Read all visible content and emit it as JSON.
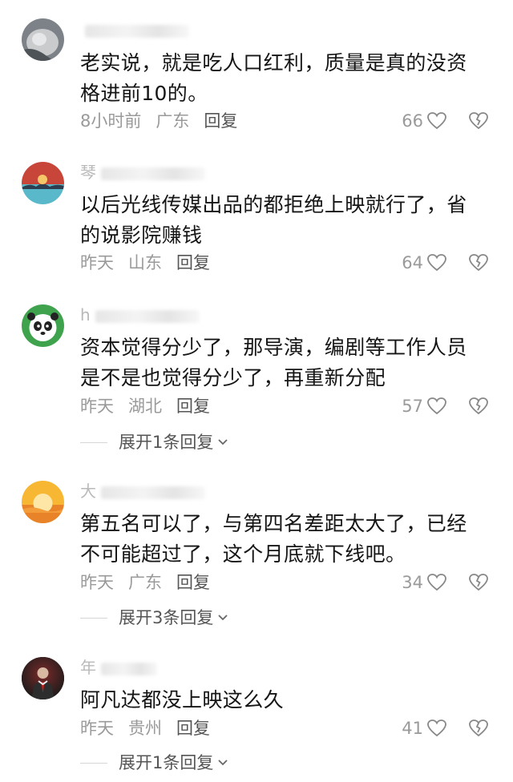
{
  "comments": [
    {
      "username_visible": "",
      "text": "老实说，就是吃人口红利，质量是真的没资\n格进前10的。",
      "time": "8小时前",
      "location": "广东",
      "reply_label": "回复",
      "likes": "66",
      "expand_label": ""
    },
    {
      "username_visible": "琴",
      "text": "以后光线传媒出品的都拒绝上映就行了，省\n的说影院赚钱",
      "time": "昨天",
      "location": "山东",
      "reply_label": "回复",
      "likes": "64",
      "expand_label": ""
    },
    {
      "username_visible": "h",
      "text": "资本觉得分少了，那导演，编剧等工作人员\n是不是也觉得分少了，再重新分配",
      "time": "昨天",
      "location": "湖北",
      "reply_label": "回复",
      "likes": "57",
      "expand_label": "展开1条回复"
    },
    {
      "username_visible": "大",
      "text": "第五名可以了，与第四名差距太大了，已经\n不可能超过了，这个月底就下线吧。",
      "time": "昨天",
      "location": "广东",
      "reply_label": "回复",
      "likes": "34",
      "expand_label": "展开3条回复"
    },
    {
      "username_visible": "年",
      "text": "阿凡达都没上映这么久",
      "time": "昨天",
      "location": "贵州",
      "reply_label": "回复",
      "likes": "41",
      "expand_label": "展开1条回复"
    }
  ],
  "icons": {
    "like": "heart-icon",
    "dislike": "broken-heart-icon",
    "expand": "chevron-down-icon"
  }
}
